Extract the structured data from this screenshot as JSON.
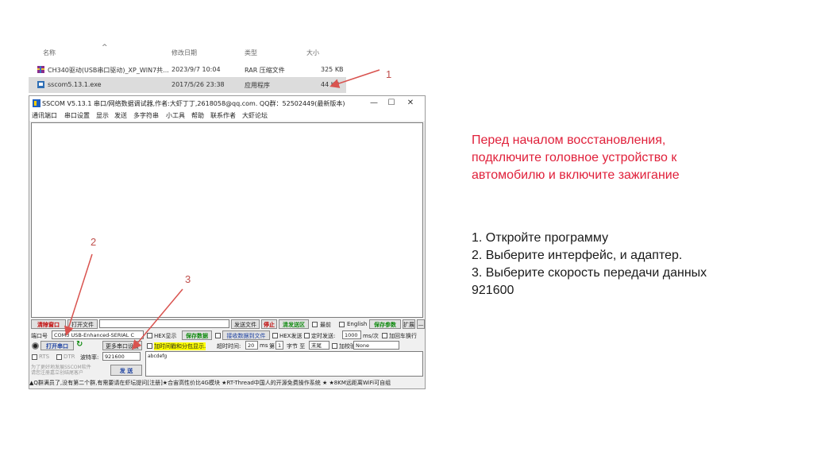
{
  "file_list": {
    "headers": {
      "name": "名称",
      "date": "修改日期",
      "type": "类型",
      "size": "大小"
    },
    "rows": [
      {
        "name": "CH340驱动(USB串口驱动)_XP_WIN7共...",
        "date": "2023/9/7 10:04",
        "type": "RAR 压缩文件",
        "size": "325 KB",
        "icon": "rar-archive-icon"
      },
      {
        "name": "sscom5.13.1.exe",
        "date": "2017/5/26 23:38",
        "type": "应用程序",
        "size": "44 KB",
        "icon": "exe-app-icon"
      }
    ]
  },
  "window": {
    "title": "SSCOM V5.13.1 串口/网络数据调试器,作者:大虾丁丁,2618058@qq.com. QQ群：52502449(最新版本)",
    "menu": [
      "通讯端口",
      "串口设置",
      "显示",
      "发送",
      "多字符串",
      "小工具",
      "帮助",
      "联系作者",
      "大虾论坛"
    ],
    "toolbar1": {
      "clear_window": "清除窗口",
      "open_file": "打开文件",
      "send_file": "发送文件",
      "stop": "停止",
      "clear_send": "清发送区",
      "topmost": "最前",
      "english": "English",
      "save_params": "保存参数",
      "expand": "扩展",
      "minus": "—"
    },
    "port": {
      "label": "端口号",
      "value": "COM3 USB-Enhanced-SERIAL C",
      "hex_display": "HEX显示",
      "save_data": "保存数据",
      "recv_to_file": "接收数据到文件",
      "hex_send": "HEX发送",
      "timed_send": "定时发送:",
      "interval": "1000",
      "interval_unit": "ms/次",
      "add_crlf": "加回车换行"
    },
    "row3": {
      "open_port": "打开串口",
      "more_settings": "更多串口设置",
      "add_timestamp": "加时间戳和分包显示.",
      "timeout_label": "超时时间:",
      "timeout_value": "20",
      "ms": "ms",
      "nth_label": "第",
      "nth_value": "1",
      "byte_to": "字节 至",
      "end_value": "末尾",
      "checksum_label": "加校验",
      "checksum_value": "None"
    },
    "row4": {
      "rts": "RTS",
      "dtr": "DTR",
      "baud_label": "波特率:",
      "baud_value": "921600",
      "send_text": "abcdefg"
    },
    "promo": "为了更好地发展SSCOM软件\n请您注册嘉立创结尾客户",
    "send_button": "发 送",
    "status": "▲Q群满员了,没有第二个群,有需要请在虾坛提问[注册]★合宙高性价比4G模块 ★RT-Thread中国人的开源免费操作系统 ★ ★8KM远距离WiFi可自组"
  },
  "annotations": {
    "step1": "1",
    "step2": "2",
    "step3": "3",
    "arrow_color": "#d9534f"
  },
  "instructions": {
    "warning": [
      "Перед началом восстановления,",
      "подключите головное устройство к",
      "автомобилю и включите зажигание"
    ],
    "steps": [
      "1. Откройте программу",
      "2. Выберите интерфейс, и адаптер.",
      "3. Выберите скорость передачи данных",
      "921600"
    ]
  }
}
